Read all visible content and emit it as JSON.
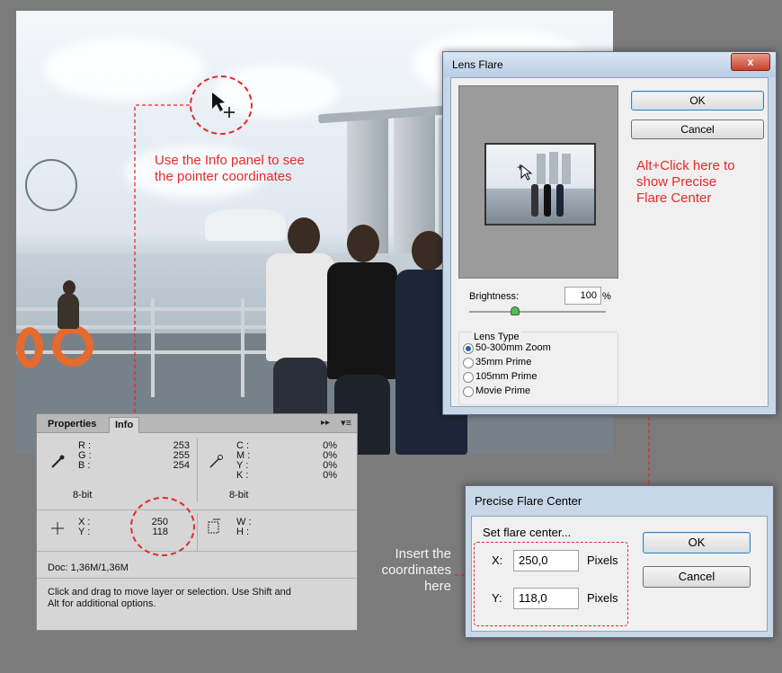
{
  "annotations": {
    "info_panel_note": "Use the Info panel to see the pointer coordinates",
    "info_panel_note_line1": "Use the Info panel to see",
    "info_panel_note_line2": "the pointer coordinates",
    "alt_click_line1": "Alt+Click here to",
    "alt_click_line2": "show Precise",
    "alt_click_line3": "Flare Center",
    "insert_line1": "Insert the",
    "insert_line2": "coordinates",
    "insert_line3": "here"
  },
  "info_panel": {
    "tabs": [
      "Properties",
      "Info"
    ],
    "active_tab": "Info",
    "rgb": {
      "R": "253",
      "G": "255",
      "B": "254"
    },
    "cmyk": {
      "C": "0%",
      "M": "0%",
      "Y": "0%",
      "K": "0%"
    },
    "labels": {
      "R": "R :",
      "G": "G :",
      "B": "B :",
      "C": "C :",
      "M": "M :",
      "Y": "Y :",
      "K": "K :",
      "X": "X :",
      "Yc": "Y :",
      "W": "W :",
      "H": "H :"
    },
    "bit_depth_left": "8-bit",
    "bit_depth_right": "8-bit",
    "x": "250",
    "y": "118",
    "doc": "Doc: 1,36M/1,36M",
    "hint": "Click and drag to move layer or selection.  Use Shift and Alt for additional options.",
    "hint_line1": "Click and drag to move layer or selection.  Use Shift and",
    "hint_line2": "Alt for additional options."
  },
  "lens_flare": {
    "title": "Lens Flare",
    "close_label": "x",
    "ok_label": "OK",
    "cancel_label": "Cancel",
    "brightness_label": "Brightness:",
    "brightness_value": "100",
    "brightness_unit": "%",
    "brightness_level": 0.33,
    "lens_type_label": "Lens Type",
    "lens_types": [
      "50-300mm Zoom",
      "35mm Prime",
      "105mm Prime",
      "Movie Prime"
    ],
    "selected_lens": "50-300mm Zoom"
  },
  "precise_flare_center": {
    "title": "Precise Flare Center",
    "subtitle": "Set flare center...",
    "x_label": "X:",
    "x_value": "250,0",
    "y_label": "Y:",
    "y_value": "118,0",
    "unit": "Pixels",
    "ok_label": "OK",
    "cancel_label": "Cancel"
  },
  "colors": {
    "annotation": "#e32b2b",
    "background": "#7b7b7b",
    "dialog_frame": "#c8d7e8"
  }
}
